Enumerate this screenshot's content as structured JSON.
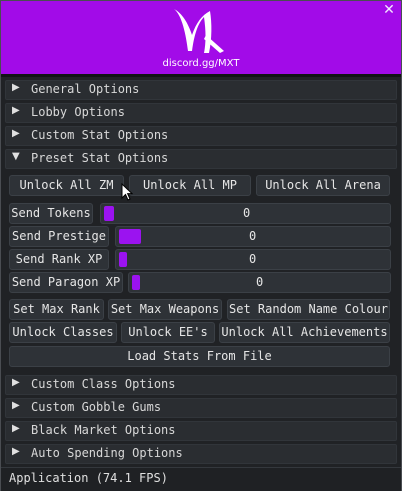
{
  "window": {
    "close_glyph": "✕",
    "accent": "#a20be8"
  },
  "header": {
    "logo_text": "discord.gg/MXT",
    "logo_icon": "mxt-logo"
  },
  "sections_top": [
    {
      "label": "General Options",
      "expanded": false
    },
    {
      "label": "Lobby Options",
      "expanded": false
    },
    {
      "label": "Custom Stat Options",
      "expanded": false
    },
    {
      "label": "Preset Stat Options",
      "expanded": true
    }
  ],
  "preset": {
    "unlock_row": [
      "Unlock All ZM",
      "Unlock All MP",
      "Unlock All Arena"
    ],
    "send_rows": [
      {
        "label": "Send Tokens",
        "value": "0"
      },
      {
        "label": "Send Prestige",
        "value": "0"
      },
      {
        "label": "Send Rank XP",
        "value": "0"
      },
      {
        "label": "Send Paragon XP",
        "value": "0"
      }
    ],
    "set_row": [
      "Set Max Rank",
      "Set Max Weapons",
      "Set Random Name Colour"
    ],
    "unlock_row2": [
      "Unlock Classes",
      "Unlock EE's",
      "Unlock All Achievements"
    ],
    "load_button": "Load Stats From File"
  },
  "sections_bottom": [
    {
      "label": "Custom Class Options",
      "expanded": false
    },
    {
      "label": "Custom Gobble Gums",
      "expanded": false
    },
    {
      "label": "Black Market Options",
      "expanded": false
    },
    {
      "label": "Auto Spending Options",
      "expanded": false
    }
  ],
  "icons": {
    "collapsed": "▶",
    "expanded": "▼"
  },
  "footer": {
    "status": "Application (74.1 FPS)"
  }
}
